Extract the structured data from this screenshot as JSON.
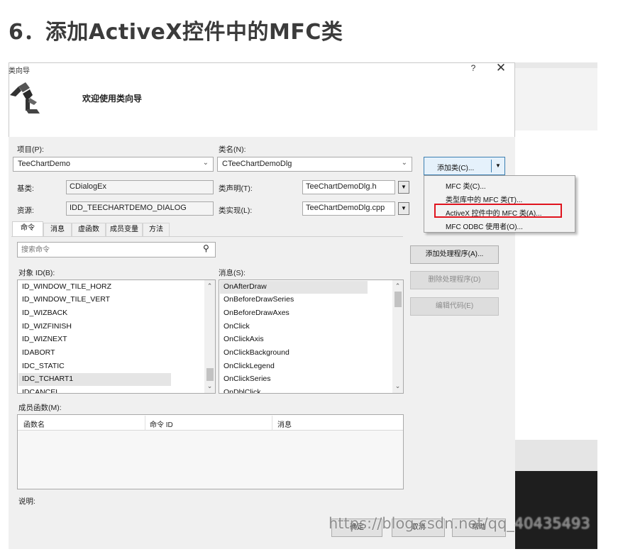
{
  "heading": "6．添加ActiveX控件中的MFC类",
  "dialog": {
    "title": "类向导",
    "help": "?",
    "close": "✕",
    "welcome": "欢迎使用类向导"
  },
  "project": {
    "label": "项目(P):",
    "value": "TeeChartDemo"
  },
  "classname": {
    "label": "类名(N):",
    "value": "CTeeChartDemoDlg"
  },
  "add_class": {
    "label": "添加类(C)...",
    "menu": [
      "MFC 类(C)...",
      "类型库中的 MFC 类(T)...",
      "ActiveX 控件中的 MFC 类(A)...",
      "MFC ODBC 使用者(O)..."
    ]
  },
  "base": {
    "label": "基类:",
    "value": "CDialogEx"
  },
  "resource": {
    "label": "资源:",
    "value": "IDD_TEECHARTDEMO_DIALOG"
  },
  "declaration": {
    "label": "类声明(T):",
    "value": "TeeChartDemoDlg.h"
  },
  "implementation": {
    "label": "类实现(L):",
    "value": "TeeChartDemoDlg.cpp"
  },
  "tabs": [
    "命令",
    "消息",
    "虚函数",
    "成员变量",
    "方法"
  ],
  "search": {
    "placeholder": "搜索命令"
  },
  "object_ids": {
    "label": "对象 ID(B):",
    "items": [
      "ID_WINDOW_TILE_HORZ",
      "ID_WINDOW_TILE_VERT",
      "ID_WIZBACK",
      "ID_WIZFINISH",
      "ID_WIZNEXT",
      "IDABORT",
      "IDC_STATIC",
      "IDC_TCHART1",
      "IDCANCEL"
    ],
    "selected": "IDC_TCHART1"
  },
  "messages": {
    "label": "消息(S):",
    "items": [
      "OnAfterDraw",
      "OnBeforeDrawSeries",
      "OnBeforeDrawAxes",
      "OnClick",
      "OnClickAxis",
      "OnClickBackground",
      "OnClickLegend",
      "OnClickSeries",
      "OnDblClick"
    ],
    "selected": "OnAfterDraw"
  },
  "buttons": {
    "add_handler": "添加处理程序(A)...",
    "delete_handler": "删除处理程序(D)",
    "edit_code": "编辑代码(E)"
  },
  "members": {
    "label": "成员函数(M):",
    "columns": [
      "函数名",
      "命令 ID",
      "消息"
    ]
  },
  "description": {
    "label": "说明:"
  },
  "footer": {
    "ok": "确定",
    "cancel": "取消",
    "help": "帮助"
  },
  "watermark": "https://blog.csdn.net/qq_40435493"
}
